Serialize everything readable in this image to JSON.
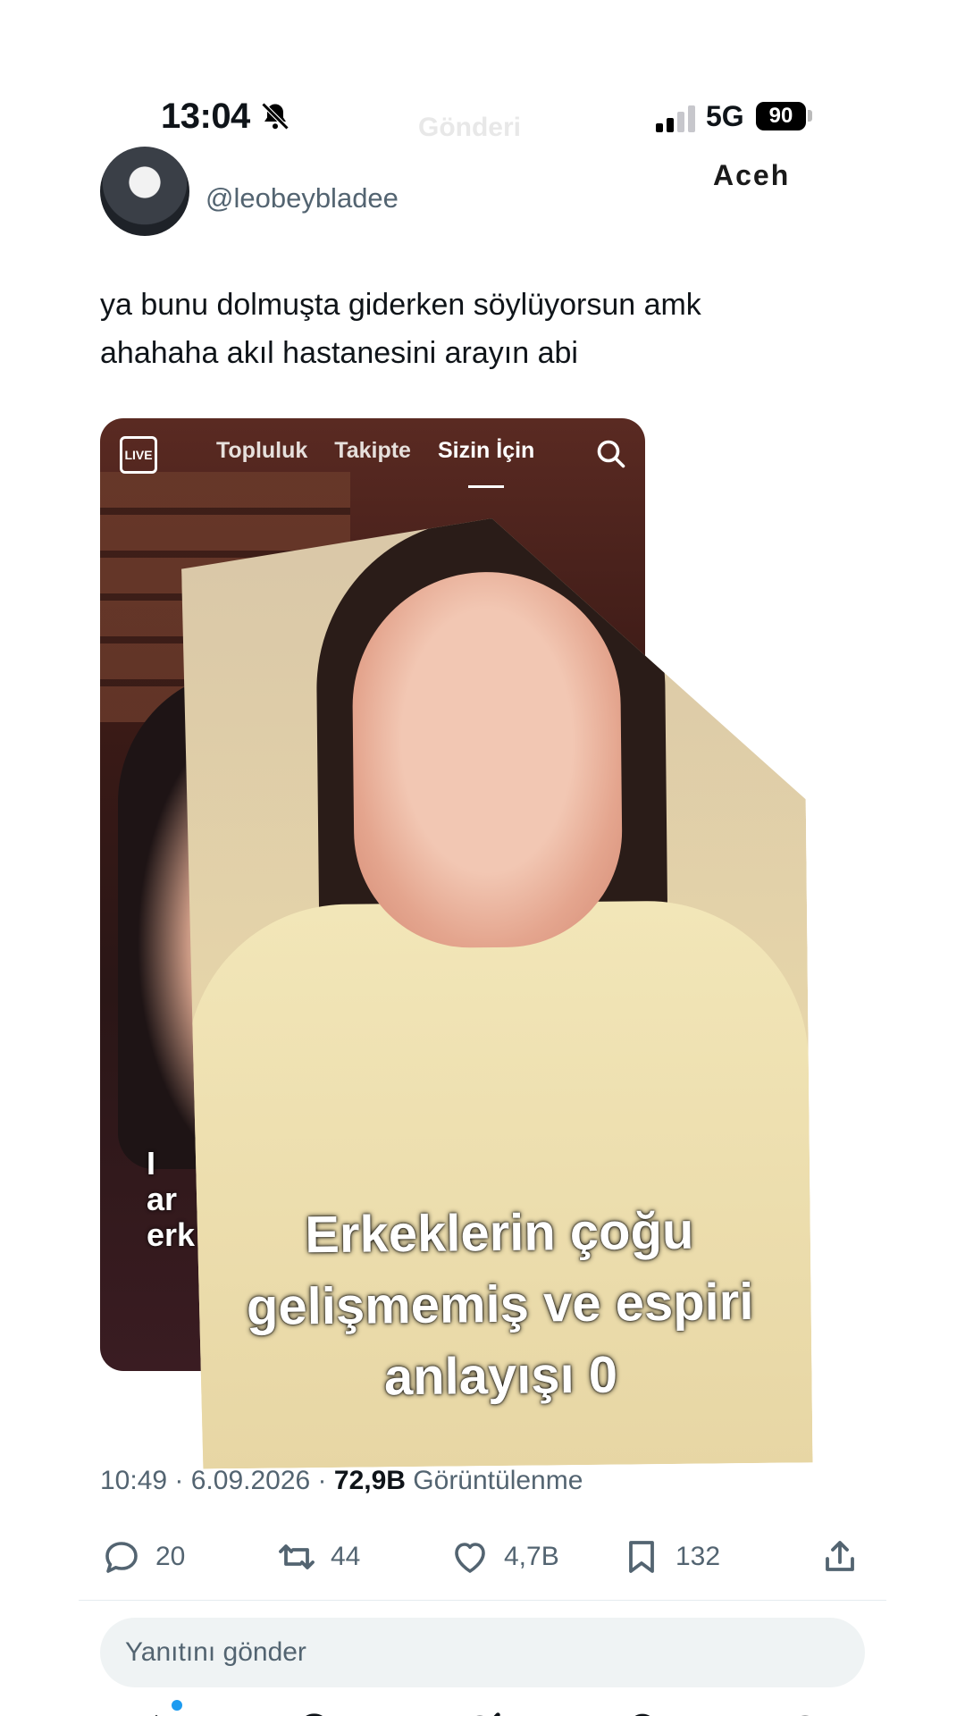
{
  "status_bar": {
    "time": "13:04",
    "network": "5G",
    "battery": "90"
  },
  "header": {
    "ghost_title": "Gönderi",
    "ghost_name": "Aceh"
  },
  "tweet": {
    "handle": "@leobeybladee",
    "text_lines": [
      "ya bunu dolmuşta giderken söylüyorsun amk",
      "ahahaha akıl hastanesini arayın abi"
    ]
  },
  "media": {
    "live_label": "LIVE",
    "tabs": [
      "Topluluk",
      "Takipte",
      "Sizin İçin"
    ],
    "active_tab": "Sizin İçin",
    "left_caption": [
      "I",
      "ar",
      "erk"
    ],
    "caption_lines": [
      "Erkeklerin çoğu",
      "gelişmemiş ve espiri",
      "anlayışı 0"
    ]
  },
  "meta": {
    "time": "10:49",
    "date": "6.09.2026",
    "views": "72,9B",
    "views_label": "Görüntülenme"
  },
  "actions": {
    "replies": "20",
    "retweets": "44",
    "likes": "4,7B",
    "bookmarks": "132"
  },
  "reply_box": {
    "placeholder": "Yanıtını gönder"
  },
  "bottom_nav": {
    "items": [
      "home-icon",
      "search-icon",
      "grok-icon",
      "notifications-icon",
      "messages-icon"
    ],
    "accent": "#1d9bf0"
  }
}
